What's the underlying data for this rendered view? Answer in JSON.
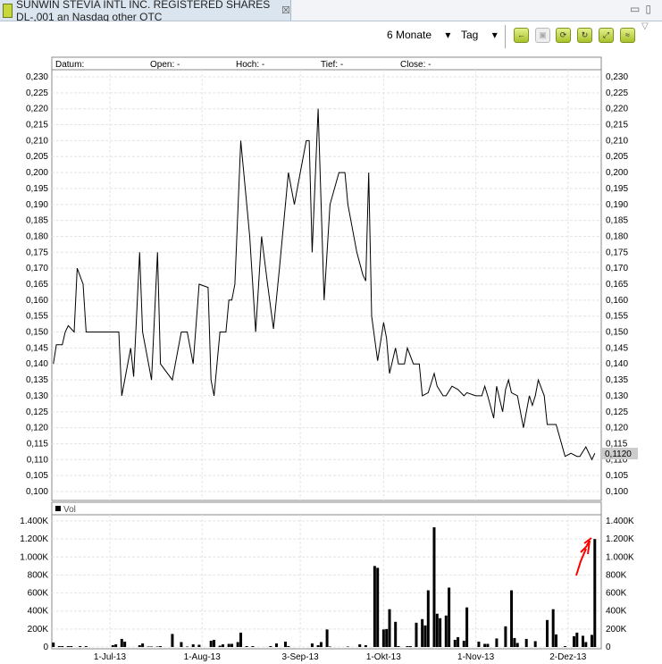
{
  "window": {
    "title": "SUNWIN STEVIA INTL INC. REGISTERED SHARES DL-,001 an Nasdaq other OTC",
    "close_glyph": "☒",
    "icons": [
      "chart-logo-icon",
      "minimize-icon",
      "maximize-icon"
    ]
  },
  "toolbar": {
    "period": "6 Monate",
    "interval": "Tag",
    "buttons": [
      "back-icon",
      "save-icon",
      "refresh-icon",
      "reload-icon",
      "expand-icon",
      "chart-icon"
    ],
    "accent": "#b5cc32"
  },
  "price_header": {
    "datum": "Datum:",
    "open": "Open: -",
    "hoch": "Hoch: -",
    "tief": "Tief: -",
    "close": "Close: -"
  },
  "volume_header": {
    "label": "Vol"
  },
  "chart_data": [
    {
      "type": "line",
      "ylim": [
        0.1,
        0.23
      ],
      "yticks": [
        "0,230",
        "0,225",
        "0,220",
        "0,215",
        "0,210",
        "0,205",
        "0,200",
        "0,195",
        "0,190",
        "0,185",
        "0,180",
        "0,175",
        "0,170",
        "0,165",
        "0,160",
        "0,155",
        "0,150",
        "0,145",
        "0,140",
        "0,135",
        "0,130",
        "0,125",
        "0,120",
        "0,115",
        "0,110",
        "0,105",
        "0,100"
      ],
      "last_value_label": "0,1120",
      "grid": true,
      "line_color": "#000000",
      "points": [
        [
          "2013-06-12",
          0.14
        ],
        [
          "2013-06-13",
          0.146
        ],
        [
          "2013-06-15",
          0.146
        ],
        [
          "2013-06-16",
          0.15
        ],
        [
          "2013-06-17",
          0.152
        ],
        [
          "2013-06-19",
          0.15
        ],
        [
          "2013-06-20",
          0.17
        ],
        [
          "2013-06-22",
          0.165
        ],
        [
          "2013-06-23",
          0.15
        ],
        [
          "2013-07-04",
          0.15
        ],
        [
          "2013-07-05",
          0.13
        ],
        [
          "2013-07-08",
          0.145
        ],
        [
          "2013-07-09",
          0.136
        ],
        [
          "2013-07-11",
          0.175
        ],
        [
          "2013-07-12",
          0.15
        ],
        [
          "2013-07-14",
          0.14
        ],
        [
          "2013-07-15",
          0.135
        ],
        [
          "2013-07-17",
          0.175
        ],
        [
          "2013-07-18",
          0.14
        ],
        [
          "2013-07-22",
          0.135
        ],
        [
          "2013-07-25",
          0.15
        ],
        [
          "2013-07-27",
          0.15
        ],
        [
          "2013-07-29",
          0.14
        ],
        [
          "2013-07-31",
          0.165
        ],
        [
          "2013-08-03",
          0.164
        ],
        [
          "2013-08-04",
          0.135
        ],
        [
          "2013-08-05",
          0.13
        ],
        [
          "2013-08-07",
          0.15
        ],
        [
          "2013-08-09",
          0.15
        ],
        [
          "2013-08-10",
          0.16
        ],
        [
          "2013-08-11",
          0.16
        ],
        [
          "2013-08-12",
          0.165
        ],
        [
          "2013-08-14",
          0.21
        ],
        [
          "2013-08-16",
          0.19
        ],
        [
          "2013-08-17",
          0.18
        ],
        [
          "2013-08-19",
          0.15
        ],
        [
          "2013-08-21",
          0.18
        ],
        [
          "2013-08-23",
          0.165
        ],
        [
          "2013-08-25",
          0.151
        ],
        [
          "2013-08-27",
          0.17
        ],
        [
          "2013-08-29",
          0.19
        ],
        [
          "2013-08-30",
          0.2
        ],
        [
          "2013-09-01",
          0.19
        ],
        [
          "2013-09-02",
          0.195
        ],
        [
          "2013-09-03",
          0.2
        ],
        [
          "2013-09-05",
          0.21
        ],
        [
          "2013-09-06",
          0.21
        ],
        [
          "2013-09-07",
          0.175
        ],
        [
          "2013-09-09",
          0.22
        ],
        [
          "2013-09-11",
          0.16
        ],
        [
          "2013-09-13",
          0.19
        ],
        [
          "2013-09-16",
          0.2
        ],
        [
          "2013-09-18",
          0.2
        ],
        [
          "2013-09-19",
          0.19
        ],
        [
          "2013-09-22",
          0.175
        ],
        [
          "2013-09-24",
          0.168
        ],
        [
          "2013-09-25",
          0.166
        ],
        [
          "2013-09-26",
          0.2
        ],
        [
          "2013-09-27",
          0.155
        ],
        [
          "2013-09-29",
          0.141
        ],
        [
          "2013-10-01",
          0.153
        ],
        [
          "2013-10-02",
          0.148
        ],
        [
          "2013-10-03",
          0.137
        ],
        [
          "2013-10-05",
          0.145
        ],
        [
          "2013-10-06",
          0.14
        ],
        [
          "2013-10-08",
          0.14
        ],
        [
          "2013-10-09",
          0.145
        ],
        [
          "2013-10-11",
          0.14
        ],
        [
          "2013-10-13",
          0.14
        ],
        [
          "2013-10-14",
          0.13
        ],
        [
          "2013-10-16",
          0.131
        ],
        [
          "2013-10-18",
          0.137
        ],
        [
          "2013-10-19",
          0.133
        ],
        [
          "2013-10-21",
          0.13
        ],
        [
          "2013-10-22",
          0.13
        ],
        [
          "2013-10-24",
          0.133
        ],
        [
          "2013-10-26",
          0.132
        ],
        [
          "2013-10-28",
          0.13
        ],
        [
          "2013-10-29",
          0.131
        ],
        [
          "2013-11-01",
          0.13
        ],
        [
          "2013-11-03",
          0.13
        ],
        [
          "2013-11-04",
          0.133
        ],
        [
          "2013-11-05",
          0.13
        ],
        [
          "2013-11-07",
          0.123
        ],
        [
          "2013-11-08",
          0.133
        ],
        [
          "2013-11-10",
          0.125
        ],
        [
          "2013-11-11",
          0.132
        ],
        [
          "2013-11-12",
          0.135
        ],
        [
          "2013-11-13",
          0.131
        ],
        [
          "2013-11-15",
          0.13
        ],
        [
          "2013-11-17",
          0.12
        ],
        [
          "2013-11-19",
          0.13
        ],
        [
          "2013-11-20",
          0.127
        ],
        [
          "2013-11-21",
          0.13
        ],
        [
          "2013-11-22",
          0.135
        ],
        [
          "2013-11-24",
          0.13
        ],
        [
          "2013-11-25",
          0.121
        ],
        [
          "2013-11-28",
          0.121
        ],
        [
          "2013-12-01",
          0.111
        ],
        [
          "2013-12-03",
          0.112
        ],
        [
          "2013-12-05",
          0.111
        ],
        [
          "2013-12-06",
          0.111
        ],
        [
          "2013-12-08",
          0.114
        ],
        [
          "2013-12-10",
          0.11
        ],
        [
          "2013-12-11",
          0.112
        ]
      ]
    },
    {
      "type": "bar",
      "ylim": [
        0,
        1400
      ],
      "unit": "K",
      "yticks": [
        "1.400K",
        "1.200K",
        "1.000K",
        "800K",
        "600K",
        "400K",
        "200K",
        "0"
      ],
      "xticks": [
        [
          "2013-07-01",
          "1-Jul-13"
        ],
        [
          "2013-08-01",
          "1-Aug-13"
        ],
        [
          "2013-09-03",
          "3-Sep-13"
        ],
        [
          "2013-10-01",
          "1-Okt-13"
        ],
        [
          "2013-11-01",
          "1-Nov-13"
        ],
        [
          "2013-12-02",
          "2-Dez-13"
        ]
      ],
      "grid": true,
      "bar_color": "#000000",
      "bars": [
        [
          "2013-06-12",
          50
        ],
        [
          "2013-06-14",
          10
        ],
        [
          "2013-06-15",
          10
        ],
        [
          "2013-06-17",
          10
        ],
        [
          "2013-06-18",
          10
        ],
        [
          "2013-06-21",
          10
        ],
        [
          "2013-06-23",
          10
        ],
        [
          "2013-07-02",
          20
        ],
        [
          "2013-07-03",
          30
        ],
        [
          "2013-07-05",
          90
        ],
        [
          "2013-07-06",
          60
        ],
        [
          "2013-07-11",
          20
        ],
        [
          "2013-07-12",
          40
        ],
        [
          "2013-07-14",
          5
        ],
        [
          "2013-07-15",
          5
        ],
        [
          "2013-07-17",
          5
        ],
        [
          "2013-07-18",
          10
        ],
        [
          "2013-07-22",
          145
        ],
        [
          "2013-07-25",
          55
        ],
        [
          "2013-07-27",
          5
        ],
        [
          "2013-07-29",
          30
        ],
        [
          "2013-07-31",
          25
        ],
        [
          "2013-08-04",
          70
        ],
        [
          "2013-08-05",
          80
        ],
        [
          "2013-08-07",
          15
        ],
        [
          "2013-08-08",
          30
        ],
        [
          "2013-08-10",
          35
        ],
        [
          "2013-08-11",
          35
        ],
        [
          "2013-08-13",
          55
        ],
        [
          "2013-08-14",
          160
        ],
        [
          "2013-08-16",
          10
        ],
        [
          "2013-08-18",
          10
        ],
        [
          "2013-08-24",
          10
        ],
        [
          "2013-08-26",
          40
        ],
        [
          "2013-08-29",
          60
        ],
        [
          "2013-08-30",
          10
        ],
        [
          "2013-09-07",
          40
        ],
        [
          "2013-09-09",
          20
        ],
        [
          "2013-09-10",
          55
        ],
        [
          "2013-09-12",
          195
        ],
        [
          "2013-09-13",
          5
        ],
        [
          "2013-09-19",
          5
        ],
        [
          "2013-09-23",
          30
        ],
        [
          "2013-09-25",
          20
        ],
        [
          "2013-09-28",
          900
        ],
        [
          "2013-09-29",
          880
        ],
        [
          "2013-10-01",
          195
        ],
        [
          "2013-10-02",
          200
        ],
        [
          "2013-10-03",
          420
        ],
        [
          "2013-10-05",
          280
        ],
        [
          "2013-10-06",
          10
        ],
        [
          "2013-10-09",
          10
        ],
        [
          "2013-10-10",
          10
        ],
        [
          "2013-10-12",
          270
        ],
        [
          "2013-10-14",
          310
        ],
        [
          "2013-10-15",
          240
        ],
        [
          "2013-10-16",
          630
        ],
        [
          "2013-10-18",
          1330
        ],
        [
          "2013-10-19",
          370
        ],
        [
          "2013-10-20",
          320
        ],
        [
          "2013-10-22",
          350
        ],
        [
          "2013-10-23",
          660
        ],
        [
          "2013-10-25",
          80
        ],
        [
          "2013-10-26",
          110
        ],
        [
          "2013-10-28",
          70
        ],
        [
          "2013-10-29",
          440
        ],
        [
          "2013-11-02",
          60
        ],
        [
          "2013-11-04",
          35
        ],
        [
          "2013-11-05",
          35
        ],
        [
          "2013-11-08",
          95
        ],
        [
          "2013-11-11",
          230
        ],
        [
          "2013-11-13",
          630
        ],
        [
          "2013-11-14",
          100
        ],
        [
          "2013-11-15",
          45
        ],
        [
          "2013-11-18",
          90
        ],
        [
          "2013-11-21",
          65
        ],
        [
          "2013-11-25",
          300
        ],
        [
          "2013-11-27",
          420
        ],
        [
          "2013-11-28",
          140
        ],
        [
          "2013-12-01",
          10
        ],
        [
          "2013-12-04",
          120
        ],
        [
          "2013-12-05",
          160
        ],
        [
          "2013-12-07",
          125
        ],
        [
          "2013-12-08",
          55
        ],
        [
          "2013-12-10",
          135
        ],
        [
          "2013-12-11",
          1200
        ]
      ]
    }
  ],
  "annotation": {
    "type": "hand-drawn-arrow",
    "color": "#ff0000"
  }
}
